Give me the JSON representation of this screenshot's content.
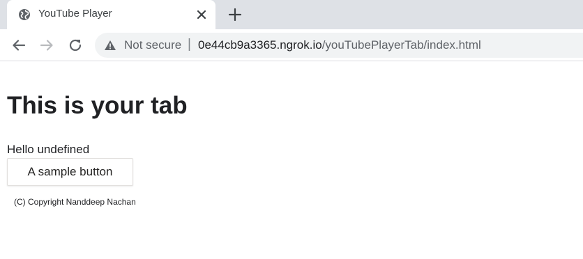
{
  "browser": {
    "tab": {
      "title": "YouTube Player",
      "icon": "globe-icon"
    },
    "toolbar": {
      "security_label": "Not secure",
      "security_icon": "warning-icon",
      "url_host": "0e44cb9a3365.ngrok.io",
      "url_path": "/youTubePlayerTab/index.html"
    }
  },
  "page": {
    "heading": "This is your tab",
    "greeting": "Hello undefined",
    "button_label": "A sample button",
    "copyright": "(C) Copyright Nanddeep Nachan"
  },
  "colors": {
    "tab_strip": "#dee1e6",
    "omnibox": "#f1f3f4",
    "text": "#202124"
  }
}
